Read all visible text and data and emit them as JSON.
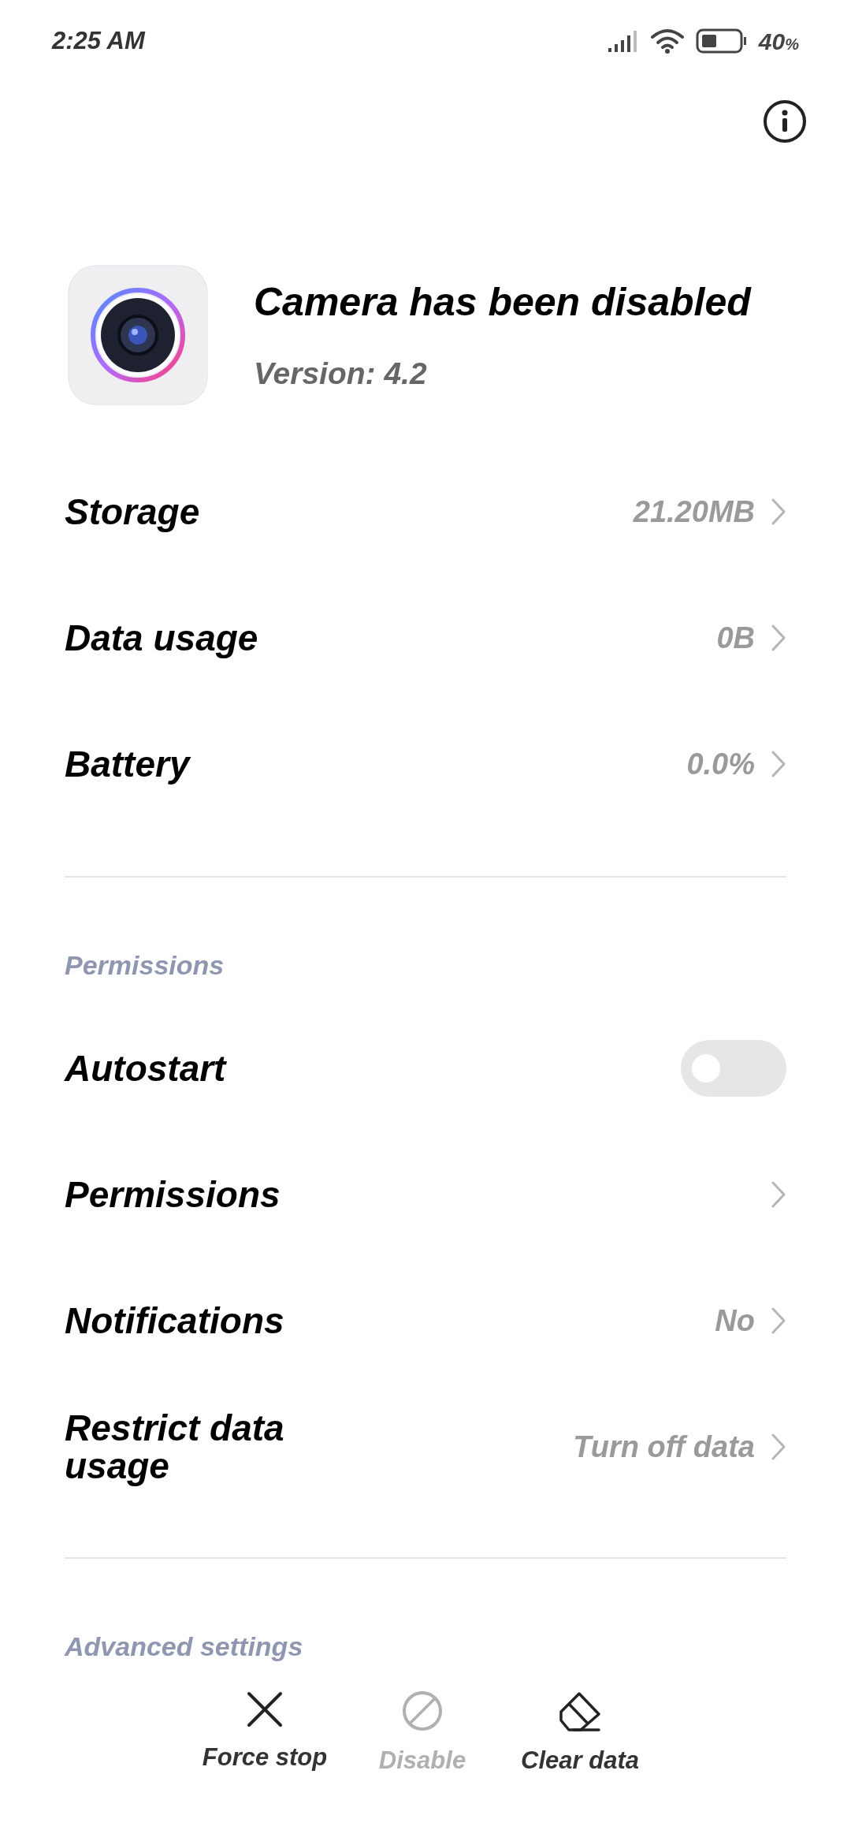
{
  "status_bar": {
    "time": "2:25 AM",
    "battery": "40",
    "battery_unit": "%"
  },
  "app": {
    "title": "Camera has been disabled",
    "version": "Version: 4.2"
  },
  "usage_rows": [
    {
      "kind": "link",
      "label": "Storage",
      "value": "21.20MB"
    },
    {
      "kind": "link",
      "label": "Data usage",
      "value": "0B"
    },
    {
      "kind": "link",
      "label": "Battery",
      "value": "0.0%"
    }
  ],
  "permissions": {
    "header": "Permissions",
    "rows": [
      {
        "kind": "toggle",
        "label": "Autostart",
        "on": false
      },
      {
        "kind": "link",
        "label": "Permissions"
      },
      {
        "kind": "link",
        "label": "Notifications",
        "value": "No"
      },
      {
        "kind": "link",
        "label": "Restrict data usage",
        "value": "Turn off data"
      }
    ]
  },
  "advanced": {
    "header": "Advanced settings"
  },
  "actions": [
    {
      "kind": "stop",
      "label": "Force stop",
      "disabled": false
    },
    {
      "kind": "disable",
      "label": "Disable",
      "disabled": true
    },
    {
      "kind": "clear",
      "label": "Clear data",
      "disabled": false
    }
  ]
}
